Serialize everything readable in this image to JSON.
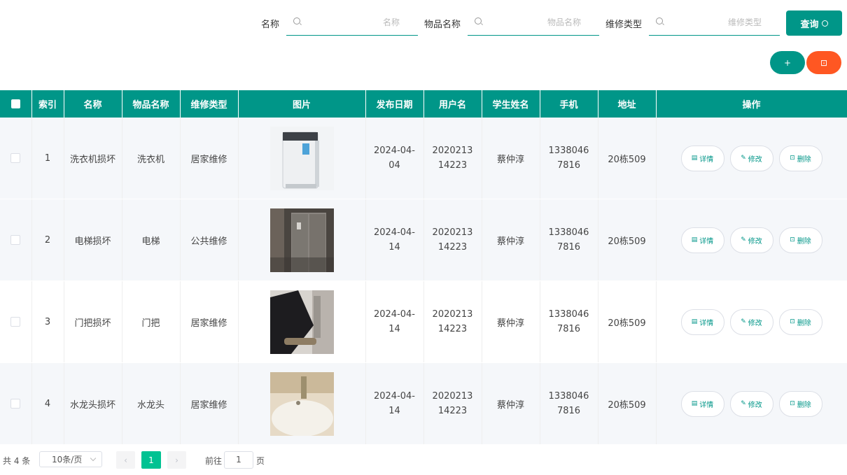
{
  "search": {
    "name_label": "名称",
    "name_placeholder": "名称",
    "item_label": "物品名称",
    "item_placeholder": "物品名称",
    "type_label": "维修类型",
    "type_placeholder": "维修类型",
    "query_label": "查询"
  },
  "actions": {
    "add_label": "+",
    "delete_label": "⊡"
  },
  "table": {
    "headers": [
      "索引",
      "名称",
      "物品名称",
      "维修类型",
      "图片",
      "发布日期",
      "用户名",
      "学生姓名",
      "手机",
      "地址",
      "操作"
    ],
    "rows": [
      {
        "index": "1",
        "name": "洗衣机损坏",
        "item": "洗衣机",
        "type": "居家维修",
        "image": "washing-machine",
        "date": "2024-04-04",
        "username": "202021314223",
        "student": "蔡仲淳",
        "phone": "13380467816",
        "address": "20栋509"
      },
      {
        "index": "2",
        "name": "电梯损坏",
        "item": "电梯",
        "type": "公共维修",
        "image": "elevator",
        "date": "2024-04-14",
        "username": "202021314223",
        "student": "蔡仲淳",
        "phone": "13380467816",
        "address": "20栋509"
      },
      {
        "index": "3",
        "name": "门把损坏",
        "item": "门把",
        "type": "居家维修",
        "image": "door-handle",
        "date": "2024-04-14",
        "username": "202021314223",
        "student": "蔡仲淳",
        "phone": "13380467816",
        "address": "20栋509"
      },
      {
        "index": "4",
        "name": "水龙头损坏",
        "item": "水龙头",
        "type": "居家维修",
        "image": "faucet",
        "date": "2024-04-14",
        "username": "202021314223",
        "student": "蔡仲淳",
        "phone": "13380467816",
        "address": "20栋509"
      }
    ],
    "op_labels": {
      "detail": "详情",
      "edit": "修改",
      "delete": "删除"
    }
  },
  "pagination": {
    "total_text": "共 4 条",
    "page_size": "10条/页",
    "current_page": "1",
    "goto_label": "前往",
    "goto_value": "1",
    "page_suffix": "页"
  },
  "colors": {
    "primary": "#009688",
    "danger": "#ff5722",
    "active_page": "#00c292"
  }
}
